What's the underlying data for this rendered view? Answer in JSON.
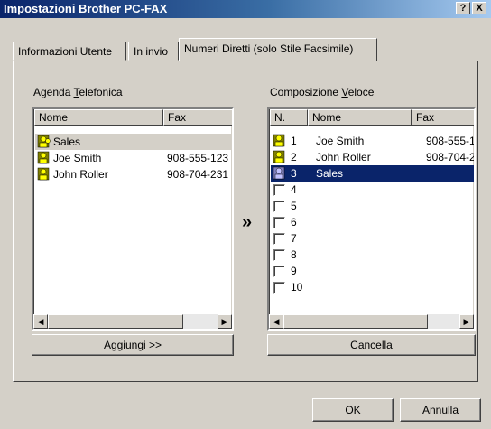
{
  "window": {
    "title": "Impostazioni Brother PC-FAX",
    "help_glyph": "?",
    "close_glyph": "X"
  },
  "tabs": [
    {
      "label": "Informazioni Utente"
    },
    {
      "label": "In invio"
    },
    {
      "label": "Numeri Diretti (solo Stile Facsimile)"
    }
  ],
  "agenda": {
    "label_pre": "Agenda ",
    "label_u": "T",
    "label_post": "elefonica",
    "col_name": "Nome",
    "col_fax": "Fax",
    "rows": [
      {
        "name": "Sales",
        "fax": ""
      },
      {
        "name": "Joe Smith",
        "fax": "908-555-123"
      },
      {
        "name": "John Roller",
        "fax": "908-704-231"
      }
    ],
    "add_button_pre": "",
    "add_button_u": "Aggiungi",
    "add_button_post": " >>"
  },
  "transfer_glyph": "»",
  "speed": {
    "label_pre": "Composizione ",
    "label_u": "V",
    "label_post": "eloce",
    "col_no": "N.",
    "col_name": "Nome",
    "col_fax": "Fax",
    "rows": [
      {
        "no": "1",
        "name": "Joe Smith",
        "fax": "908-555-1"
      },
      {
        "no": "2",
        "name": "John Roller",
        "fax": "908-704-2"
      },
      {
        "no": "3",
        "name": "Sales",
        "fax": ""
      },
      {
        "no": "4",
        "name": "",
        "fax": ""
      },
      {
        "no": "5",
        "name": "",
        "fax": ""
      },
      {
        "no": "6",
        "name": "",
        "fax": ""
      },
      {
        "no": "7",
        "name": "",
        "fax": ""
      },
      {
        "no": "8",
        "name": "",
        "fax": ""
      },
      {
        "no": "9",
        "name": "",
        "fax": ""
      },
      {
        "no": "10",
        "name": "",
        "fax": ""
      }
    ],
    "selected_row": 3,
    "delete_button_u": "C",
    "delete_button_post": "ancella"
  },
  "footer": {
    "ok": "OK",
    "cancel": "Annulla"
  },
  "colors": {
    "selection": "#0a246a",
    "face": "#d4d0c8"
  }
}
